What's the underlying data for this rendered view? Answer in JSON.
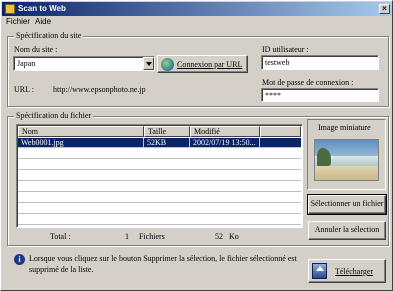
{
  "window": {
    "title": "Scan to Web",
    "close_glyph": "×"
  },
  "menu": {
    "items": [
      "Fichier",
      "Aide"
    ]
  },
  "site_spec": {
    "legend": "Spécification du site",
    "site_label": "Nom du site :",
    "site_value": "Japan",
    "connect_label": "Connexion par URL",
    "url_label": "URL :",
    "url_value": "http://www.epsonphoto.ne.jp",
    "user_label": "ID utilisateur :",
    "user_value": "testweb",
    "password_label": "Mot de passe de connexion :",
    "password_value": "****"
  },
  "file_spec": {
    "legend": "Spécification du fichier",
    "columns": [
      "Nom",
      "Taille",
      "Modifié"
    ],
    "rows": [
      {
        "name": "Web0001.jpg",
        "size": "52KB",
        "modified": "2002/07/19 13:50..."
      }
    ],
    "total_label": "Total :",
    "total_count": "1",
    "files_label": "Fichiers",
    "total_size": "52",
    "size_unit": "Ko"
  },
  "thumbnail": {
    "label": "Image miniature"
  },
  "buttons": {
    "select_file": "Sélectionner un fichier",
    "cancel_selection": "Annuler la sélection",
    "upload": "Télécharger"
  },
  "info": {
    "text_line1": "Lorsque vous cliquez sur le bouton Supprimer la sélection, le fichier sélectionné est",
    "text_line2": "supprimé de la liste."
  },
  "colors": {
    "selection": "#0a246a",
    "titlebar": "#0a246a",
    "face": "#d4d0c8"
  }
}
